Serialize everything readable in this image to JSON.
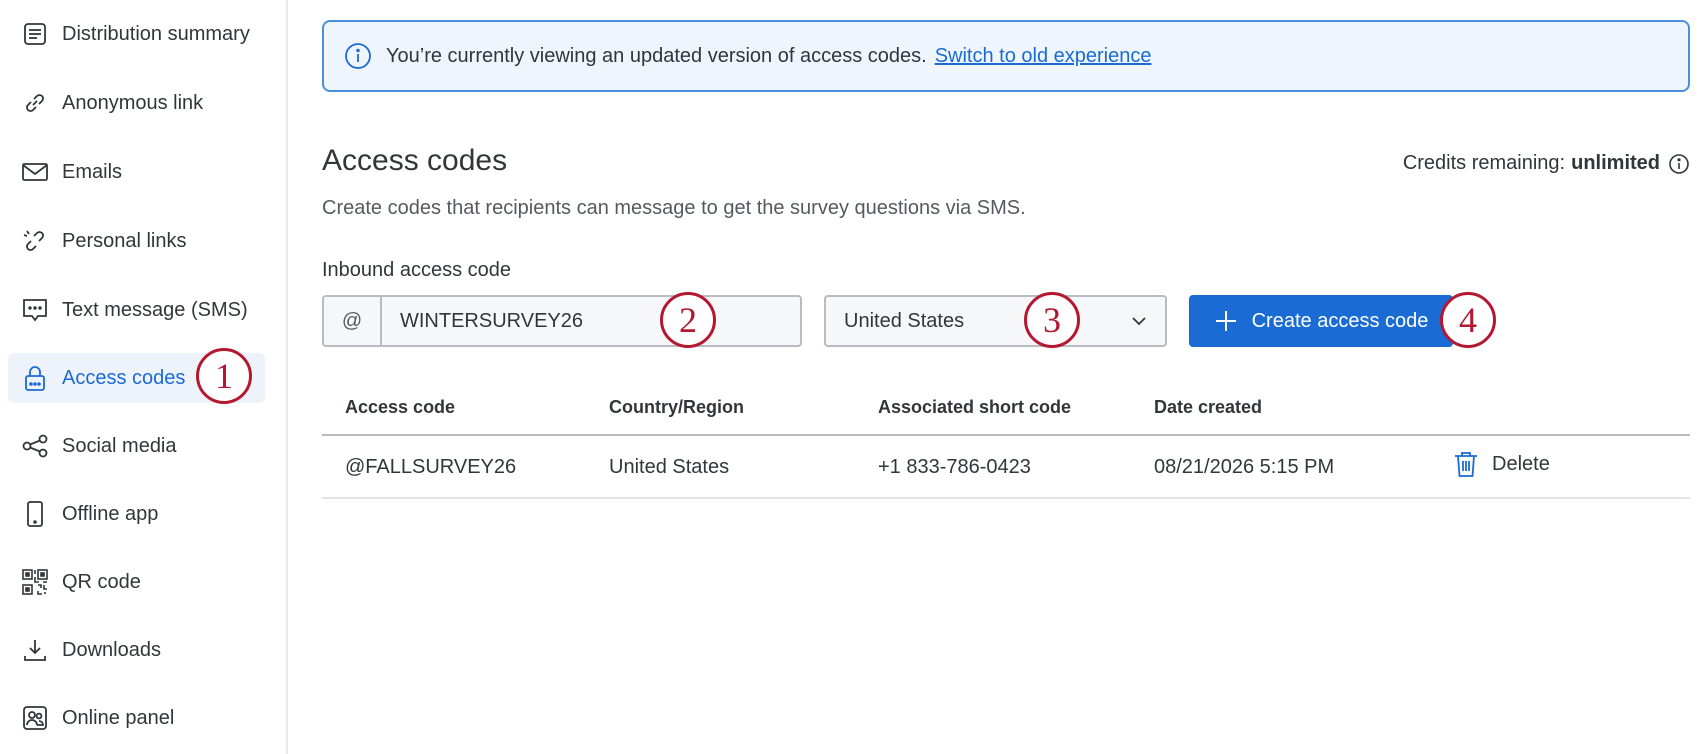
{
  "sidebar": {
    "items": [
      {
        "label": "Distribution summary",
        "icon": "distribution-summary-icon",
        "active": false
      },
      {
        "label": "Anonymous link",
        "icon": "link-icon",
        "active": false
      },
      {
        "label": "Emails",
        "icon": "envelope-icon",
        "active": false
      },
      {
        "label": "Personal links",
        "icon": "broken-link-icon",
        "active": false
      },
      {
        "label": "Text message (SMS)",
        "icon": "message-icon",
        "active": false
      },
      {
        "label": "Access codes",
        "icon": "lock-icon",
        "active": true
      },
      {
        "label": "Social media",
        "icon": "share-icon",
        "active": false
      },
      {
        "label": "Offline app",
        "icon": "phone-icon",
        "active": false
      },
      {
        "label": "QR code",
        "icon": "qr-code-icon",
        "active": false
      },
      {
        "label": "Downloads",
        "icon": "download-icon",
        "active": false
      },
      {
        "label": "Online panel",
        "icon": "panel-icon",
        "active": false
      }
    ]
  },
  "banner": {
    "text": "You’re currently viewing an updated version of access codes.",
    "link": "Switch to old experience"
  },
  "main": {
    "title": "Access codes",
    "credits_label": "Credits remaining:",
    "credits_value": "unlimited",
    "subtitle": "Create codes that recipients can message to get the survey questions via SMS.",
    "field_label": "Inbound access code",
    "code_prefix": "@",
    "code_value": "WINTERSURVEY26",
    "country_value": "United States",
    "create_button": "Create access code"
  },
  "table": {
    "headers": [
      "Access code",
      "Country/Region",
      "Associated short code",
      "Date created"
    ],
    "rows": [
      {
        "code": "@FALLSURVEY26",
        "country": "United States",
        "short_code": "+1 833-786-0423",
        "date": "08/21/2026 5:15 PM",
        "action": "Delete"
      }
    ]
  },
  "callouts": [
    "1",
    "2",
    "3",
    "4"
  ],
  "colors": {
    "accent": "#1a6bd4",
    "callout": "#b5172f",
    "active_bg": "#eef3fb"
  }
}
